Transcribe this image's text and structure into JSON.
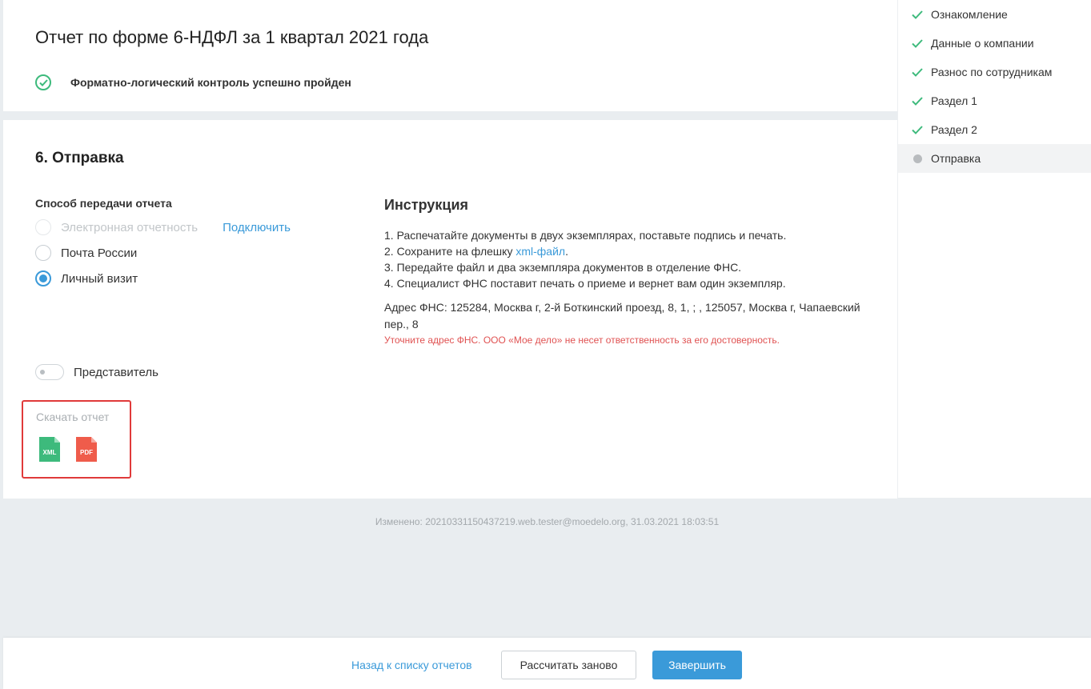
{
  "header": {
    "title": "Отчет по форме 6-НДФЛ за 1 квартал 2021 года",
    "check_status": "Форматно-логический контроль успешно пройден"
  },
  "section": {
    "title": "6. Отправка",
    "method_label": "Способ передачи отчета",
    "options": [
      {
        "label": "Электронная отчетность",
        "disabled": true,
        "checked": false
      },
      {
        "label": "Почта России",
        "disabled": false,
        "checked": false
      },
      {
        "label": "Личный визит",
        "disabled": false,
        "checked": true
      }
    ],
    "connect_link": "Подключить",
    "representative_label": "Представитель",
    "representative_on": false,
    "download": {
      "title": "Скачать отчет",
      "xml_label": "XML",
      "pdf_label": "PDF",
      "xml_color": "#3dba7c",
      "pdf_color": "#ef5c4b"
    }
  },
  "instruction": {
    "title": "Инструкция",
    "steps": [
      "1. Распечатайте документы в двух экземплярах, поставьте подпись и печать.",
      "2. Сохраните на флешку ",
      "3. Передайте файл и два экземпляра документов в отделение ФНС.",
      "4. Специалист ФНС поставит печать о приеме и вернет вам один экземпляр."
    ],
    "xml_link": "xml-файл",
    "step2_end": ".",
    "address": "Адрес ФНС: 125284, Москва г, 2-й Боткинский проезд, 8, 1, ; , 125057, Москва г, Чапаевский пер., 8",
    "warning": "Уточните адрес ФНС. ООО «Мое дело» не несет ответственность за его достоверность."
  },
  "sidebar": {
    "steps": [
      {
        "label": "Ознакомление",
        "state": "done"
      },
      {
        "label": "Данные о компании",
        "state": "done"
      },
      {
        "label": "Разнос по сотрудникам",
        "state": "done"
      },
      {
        "label": "Раздел 1",
        "state": "done"
      },
      {
        "label": "Раздел 2",
        "state": "done"
      },
      {
        "label": "Отправка",
        "state": "current"
      }
    ]
  },
  "modified": "Изменено: 20210331150437219.web.tester@moedelo.org, 31.03.2021 18:03:51",
  "footer": {
    "back_label": "Назад к списку отчетов",
    "recalc_label": "Рассчитать заново",
    "finish_label": "Завершить"
  },
  "colors": {
    "accent": "#3a9ad9",
    "success": "#3dba7c",
    "warning": "#e05252"
  }
}
